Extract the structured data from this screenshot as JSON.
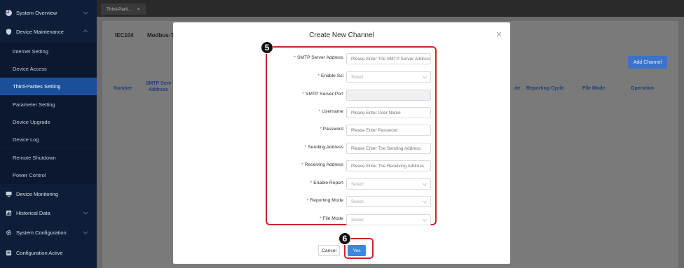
{
  "colors": {
    "sidebar_bg": "#0e1e38",
    "active_item": "#1a4f9c",
    "accent": "#3d86e0",
    "highlight": "#d31f2b",
    "required": "#e0342f"
  },
  "sidebar": {
    "items": [
      {
        "label": "System Overview",
        "icon": "pie-chart-icon",
        "expandable": true
      },
      {
        "label": "Device Maintenance",
        "icon": "shield-icon",
        "expandable": true,
        "expanded": true,
        "children": [
          {
            "label": "Internet Setting"
          },
          {
            "label": "Device Access"
          },
          {
            "label": "Third-Parties Setting",
            "active": true
          },
          {
            "label": "Parameter Setting"
          },
          {
            "label": "Device Upgrade"
          },
          {
            "label": "Device Log"
          },
          {
            "label": "Remote Shutdown"
          },
          {
            "label": "Power Control"
          }
        ]
      },
      {
        "label": "Device Monitoring",
        "icon": "monitor-icon",
        "expandable": false
      },
      {
        "label": "Historical Data",
        "icon": "history-icon",
        "expandable": true
      },
      {
        "label": "System Configuration",
        "icon": "gear-icon",
        "expandable": true
      },
      {
        "label": "Configuration Active",
        "icon": "config-icon",
        "expandable": false
      }
    ]
  },
  "tabbar": {
    "tab_label": "Third-Parti...",
    "close_glyph": "×"
  },
  "content": {
    "protocol_tabs": [
      "IEC104",
      "Modbus-T"
    ],
    "add_channel_label": "Add Channel",
    "table_headers": [
      "Number",
      "SMTP Serv Address",
      "de",
      "Reporting Cycle",
      "File Mode",
      "Operation"
    ]
  },
  "dialog": {
    "title": "Create New Channel",
    "close_glyph": "×",
    "fields": [
      {
        "label": "SMTP Server Address",
        "placeholder": "Please Enter The SMTP Server Address",
        "type": "input"
      },
      {
        "label": "Enable Ssl",
        "placeholder": "Select",
        "type": "select"
      },
      {
        "label": "SMTP Server Port",
        "placeholder": "",
        "type": "disabled"
      },
      {
        "label": "Username",
        "placeholder": "Please Enter User Name",
        "type": "input"
      },
      {
        "label": "Password",
        "placeholder": "Please Enter Password",
        "type": "input"
      },
      {
        "label": "Sending Address",
        "placeholder": "Please Enter The Sending Address",
        "type": "input"
      },
      {
        "label": "Receiving Address",
        "placeholder": "Please Enter The Receiving Address",
        "type": "input"
      },
      {
        "label": "Enable Report",
        "placeholder": "Select",
        "type": "select"
      },
      {
        "label": "Reporting Mode",
        "placeholder": "Select",
        "type": "select"
      },
      {
        "label": "File Mode",
        "placeholder": "Select",
        "type": "select"
      }
    ],
    "required_mark": "*",
    "cancel_label": "Cancel",
    "yes_label": "Yes"
  },
  "annotations": {
    "form_step": "5",
    "yes_step": "6"
  }
}
